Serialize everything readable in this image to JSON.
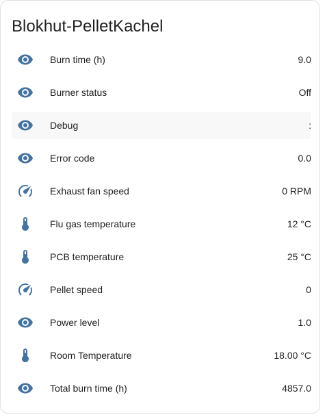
{
  "card": {
    "title": "Blokhut-PelletKachel"
  },
  "icon_color": "#44739e",
  "entities": [
    {
      "icon": "eye-icon",
      "name": "Burn time (h)",
      "state": "9.0"
    },
    {
      "icon": "eye-icon",
      "name": "Burner status",
      "state": "Off"
    },
    {
      "icon": "eye-icon",
      "name": "Debug",
      "state": ":"
    },
    {
      "icon": "eye-icon",
      "name": "Error code",
      "state": "0.0"
    },
    {
      "icon": "gauge-icon",
      "name": "Exhaust fan speed",
      "state": "0 RPM"
    },
    {
      "icon": "thermometer-icon",
      "name": "Flu gas temperature",
      "state": "12 °C"
    },
    {
      "icon": "thermometer-icon",
      "name": "PCB temperature",
      "state": "25 °C"
    },
    {
      "icon": "gauge-icon",
      "name": "Pellet speed",
      "state": "0"
    },
    {
      "icon": "eye-icon",
      "name": "Power level",
      "state": "1.0"
    },
    {
      "icon": "thermometer-icon",
      "name": "Room Temperature",
      "state": "18.00 °C"
    },
    {
      "icon": "eye-icon",
      "name": "Total burn time (h)",
      "state": "4857.0"
    }
  ]
}
